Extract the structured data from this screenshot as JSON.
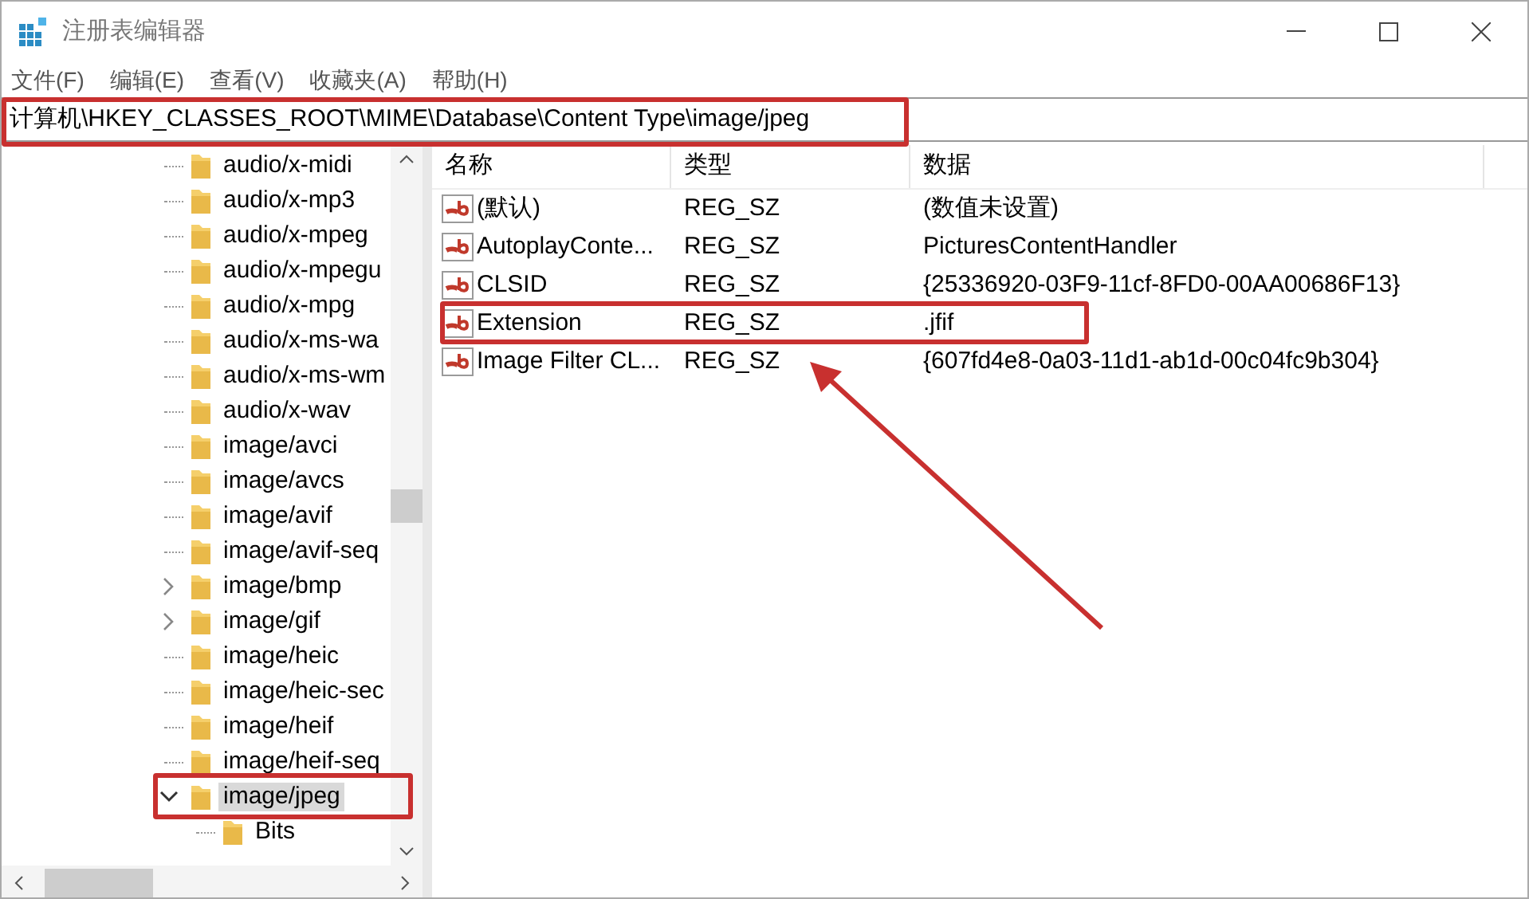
{
  "window": {
    "title": "注册表编辑器"
  },
  "menu": [
    "文件(F)",
    "编辑(E)",
    "查看(V)",
    "收藏夹(A)",
    "帮助(H)"
  ],
  "address": "计算机\\HKEY_CLASSES_ROOT\\MIME\\Database\\Content Type\\image/jpeg",
  "tree": [
    {
      "label": "audio/x-midi",
      "kind": "leaf",
      "selected": false
    },
    {
      "label": "audio/x-mp3",
      "kind": "leaf",
      "selected": false
    },
    {
      "label": "audio/x-mpeg",
      "kind": "leaf",
      "selected": false
    },
    {
      "label": "audio/x-mpegu",
      "kind": "leaf",
      "selected": false
    },
    {
      "label": "audio/x-mpg",
      "kind": "leaf",
      "selected": false
    },
    {
      "label": "audio/x-ms-wa",
      "kind": "leaf",
      "selected": false
    },
    {
      "label": "audio/x-ms-wm",
      "kind": "leaf",
      "selected": false
    },
    {
      "label": "audio/x-wav",
      "kind": "leaf",
      "selected": false
    },
    {
      "label": "image/avci",
      "kind": "leaf",
      "selected": false
    },
    {
      "label": "image/avcs",
      "kind": "leaf",
      "selected": false
    },
    {
      "label": "image/avif",
      "kind": "leaf",
      "selected": false
    },
    {
      "label": "image/avif-seq",
      "kind": "leaf",
      "selected": false
    },
    {
      "label": "image/bmp",
      "kind": "collapsed",
      "selected": false
    },
    {
      "label": "image/gif",
      "kind": "collapsed",
      "selected": false
    },
    {
      "label": "image/heic",
      "kind": "leaf",
      "selected": false
    },
    {
      "label": "image/heic-sec",
      "kind": "leaf",
      "selected": false
    },
    {
      "label": "image/heif",
      "kind": "leaf",
      "selected": false
    },
    {
      "label": "image/heif-seq",
      "kind": "leaf",
      "selected": false
    },
    {
      "label": "image/jpeg",
      "kind": "expanded",
      "selected": true,
      "children": [
        {
          "label": "Bits",
          "kind": "leaf",
          "selected": false
        }
      ]
    }
  ],
  "columns": [
    "名称",
    "类型",
    "数据"
  ],
  "values": [
    {
      "name": "(默认)",
      "type": "REG_SZ",
      "data": "(数值未设置)"
    },
    {
      "name": "AutoplayConte...",
      "type": "REG_SZ",
      "data": "PicturesContentHandler"
    },
    {
      "name": "CLSID",
      "type": "REG_SZ",
      "data": "{25336920-03F9-11cf-8FD0-00AA00686F13}"
    },
    {
      "name": "Extension",
      "type": "REG_SZ",
      "data": ".jfif"
    },
    {
      "name": "Image Filter CL...",
      "type": "REG_SZ",
      "data": "{607fd4e8-0a03-11d1-ab1d-00c04fc9b304}"
    }
  ]
}
